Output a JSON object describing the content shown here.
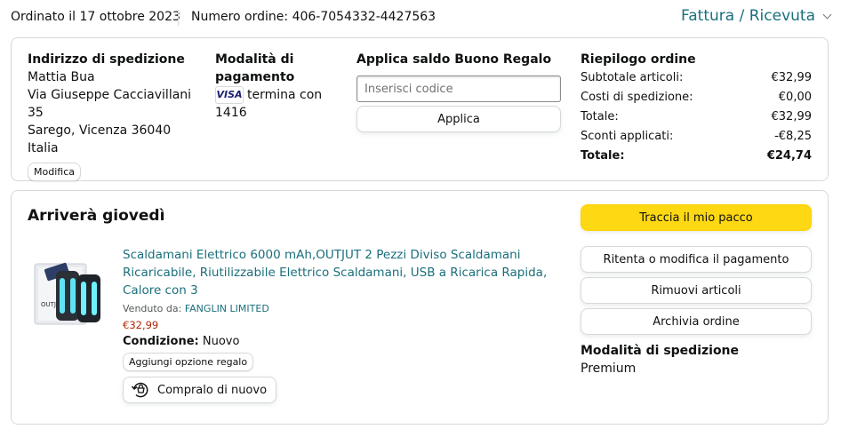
{
  "header": {
    "order_date": "Ordinato il 17 ottobre 2023",
    "order_number": "Numero ordine: 406-7054332-4427563",
    "invoice_label": "Fattura / Ricevuta"
  },
  "shipping_address": {
    "title": "Indirizzo di spedizione",
    "lines": [
      "Mattia Bua",
      "Via Giuseppe Cacciavillani 35",
      "Sarego, Vicenza 36040",
      "Italia"
    ],
    "edit_label": "Modifica"
  },
  "payment": {
    "title": "Modalità di pagamento",
    "card_brand": "VISA",
    "card_text": "termina con 1416"
  },
  "gift_card": {
    "title": "Applica saldo Buono Regalo",
    "placeholder": "Inserisci codice",
    "apply_label": "Applica"
  },
  "summary": {
    "title": "Riepilogo ordine",
    "rows": [
      {
        "label": "Subtotale articoli:",
        "value": "€32,99"
      },
      {
        "label": "Costi di spedizione:",
        "value": "€0,00"
      },
      {
        "label": "Totale:",
        "value": "€32,99"
      },
      {
        "label": "Sconti applicati:",
        "value": "-€8,25"
      },
      {
        "label": "Totale:",
        "value": "€24,74"
      }
    ]
  },
  "shipment": {
    "arrival": "Arriverà giovedì",
    "product_title": "Scaldamani Elettrico 6000 mAh,OUTJUT 2 Pezzi Diviso Scaldamani Ricaricabile, Riutilizzabile Elettrico Scaldamani, USB a Ricarica Rapida, Calore con 3",
    "sold_by_label": "Venduto da:",
    "seller": "FANGLIN LIMITED",
    "price": "€32,99",
    "condition_label": "Condizione:",
    "condition_value": "Nuovo",
    "gift_option_label": "Aggiungi opzione regalo",
    "buy_again_label": "Compralo di nuovo",
    "image_brand": "OUTJUT"
  },
  "actions": {
    "track_label": "Traccia il mio pacco",
    "retry_payment_label": "Ritenta o modifica il pagamento",
    "remove_items_label": "Rimuovi articoli",
    "archive_label": "Archivia ordine",
    "shipping_method_title": "Modalità di spedizione",
    "shipping_method_value": "Premium"
  },
  "colors": {
    "link": "#1a6f7b",
    "price": "#b12704",
    "track_button": "#ffd814",
    "border": "#d5d9d9"
  }
}
